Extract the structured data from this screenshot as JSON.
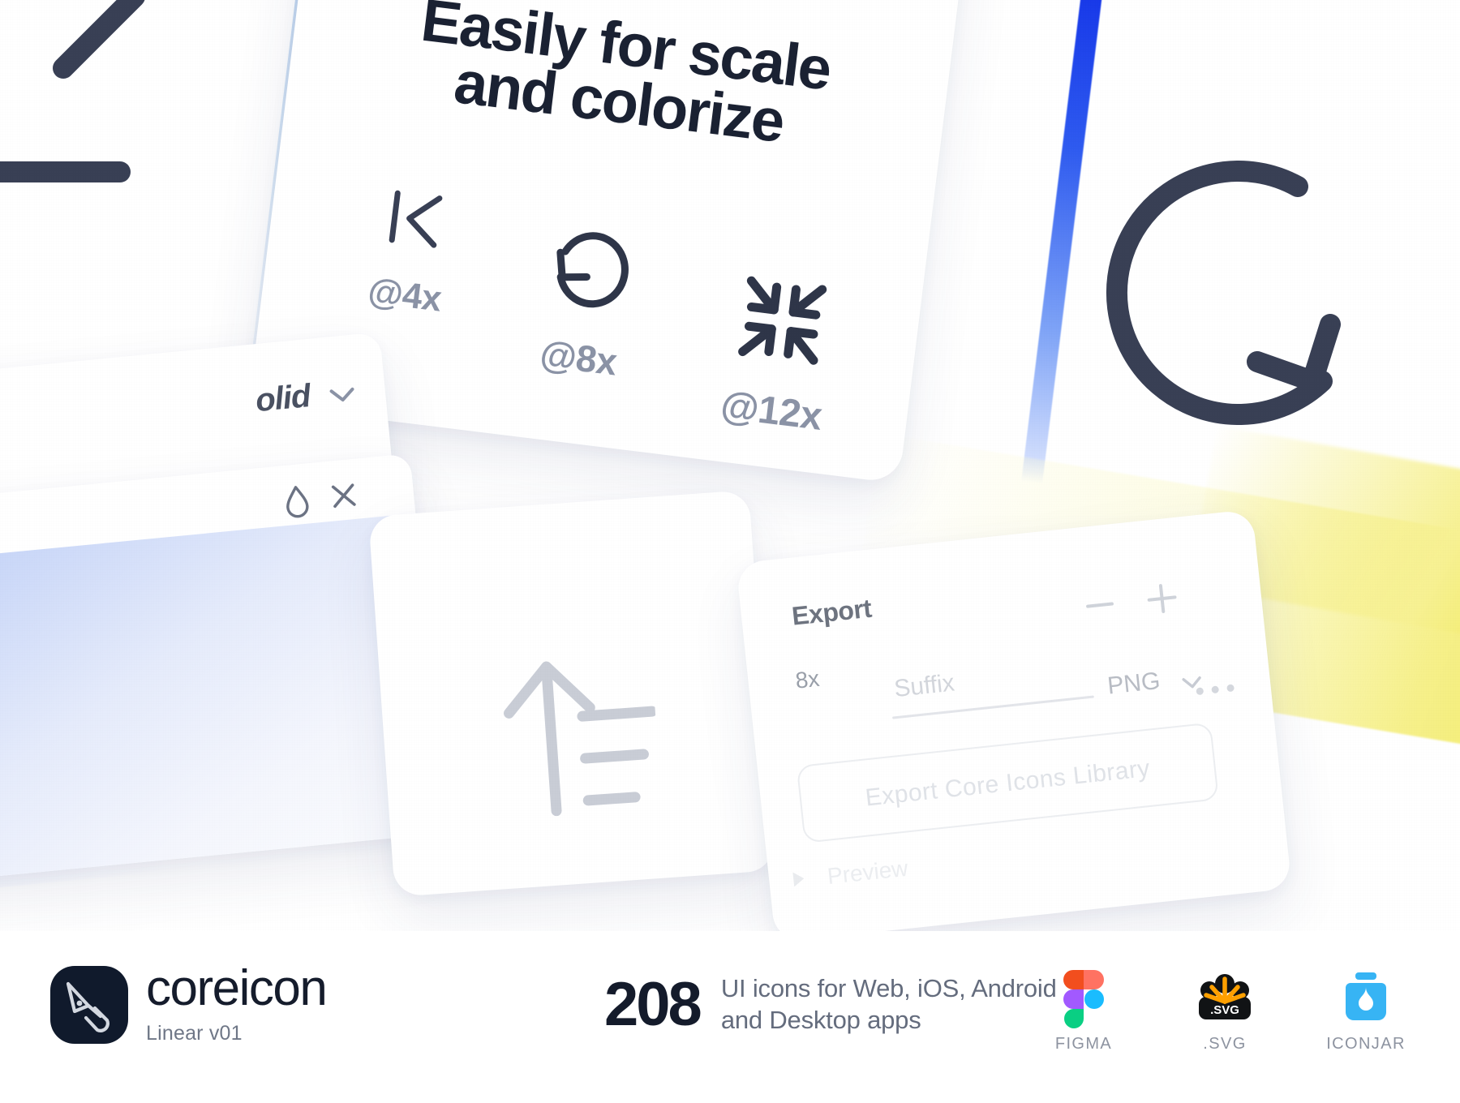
{
  "hero": {
    "title_line1": "Easily for scale",
    "title_line2": "and colorize",
    "scales": [
      {
        "icon": "skip-back-icon",
        "label": "@4x"
      },
      {
        "icon": "rotate-ccw-icon",
        "label": "@8x"
      },
      {
        "icon": "minimize-icon",
        "label": "@12x"
      }
    ]
  },
  "solid_panel": {
    "style_value": "olid",
    "chevron_icon": "chevron-down-icon",
    "window_icons": [
      "droplet-icon",
      "close-icon"
    ]
  },
  "upload_card": {
    "icon": "sort-ascending-icon"
  },
  "export_panel": {
    "title": "Export",
    "scale_value": "8x",
    "suffix_placeholder": "Suffix",
    "format_value": "PNG",
    "format_chevron_icon": "chevron-down-icon",
    "minus_label": "minus-icon",
    "plus_label": "plus-icon",
    "overflow_icon": "more-horizontal-icon",
    "export_button_label": "Export Core Icons Library",
    "preview_label": "Preview",
    "preview_disclosure_icon": "triangle-right-icon"
  },
  "decorations": {
    "top_left_icon": "log-out-icon",
    "right_icon": "rotate-left-icon"
  },
  "footer": {
    "brand_name": "coreicon",
    "brand_version": "Linear v01",
    "brand_logo_icon": "pen-nib-icon",
    "icon_count": "208",
    "description_line1": "UI icons for Web, iOS, Android",
    "description_line2": "and Desktop apps",
    "formats": [
      {
        "label": "FIGMA",
        "icon": "figma-logo-icon"
      },
      {
        "label": ".SVG",
        "icon": "svg-badge-icon"
      },
      {
        "label": "ICONJAR",
        "icon": "iconjar-logo-icon"
      }
    ]
  },
  "colors": {
    "ink": "#1b2233",
    "muted": "#8b93a6",
    "accent_blue": "#1433e8",
    "accent_yellow": "#f2eb60",
    "figma_red": "#f24e1e",
    "figma_purple": "#a259ff",
    "figma_blue": "#1abcfe",
    "figma_green": "#0acf83",
    "svg_orange": "#ffa000",
    "iconjar_blue": "#37b4f4"
  }
}
